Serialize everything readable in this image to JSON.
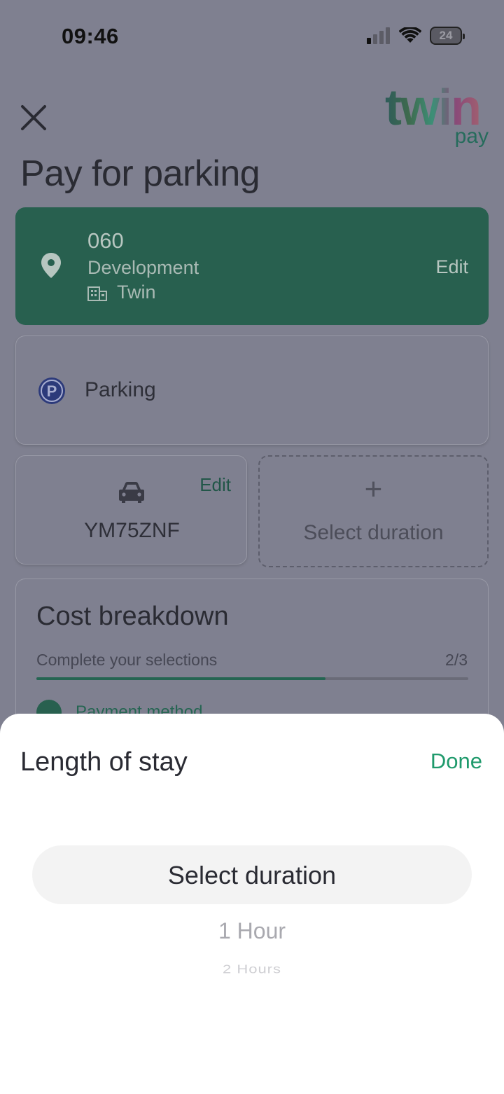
{
  "status_bar": {
    "time": "09:46",
    "battery": "24",
    "icons": [
      "signal-icon",
      "wifi-icon",
      "battery-icon"
    ]
  },
  "header": {
    "close_icon": "close-icon",
    "logo_text": "twin",
    "logo_sub": "pay",
    "title": "Pay for parking"
  },
  "location": {
    "code": "060",
    "name": "Development",
    "organisation": "Twin",
    "edit_label": "Edit",
    "icon": "location-pin-icon",
    "org_icon": "building-icon"
  },
  "service": {
    "label": "Parking",
    "icon": "parking-icon"
  },
  "vehicle": {
    "plate": "YM75ZNF",
    "edit_label": "Edit",
    "icon": "car-icon"
  },
  "duration": {
    "plus": "+",
    "label": "Select duration"
  },
  "cost": {
    "title": "Cost breakdown",
    "subtitle": "Complete your selections",
    "step": "2/3",
    "progress": 0.67,
    "payment_method_label": "Payment method"
  },
  "sheet": {
    "title": "Length of stay",
    "done_label": "Done",
    "selected": "Select duration",
    "options": [
      "1 Hour",
      "2 Hours"
    ]
  },
  "colors": {
    "accent": "#1f9a6c",
    "card_green": "#28604f",
    "overlay": "#7f8090"
  }
}
